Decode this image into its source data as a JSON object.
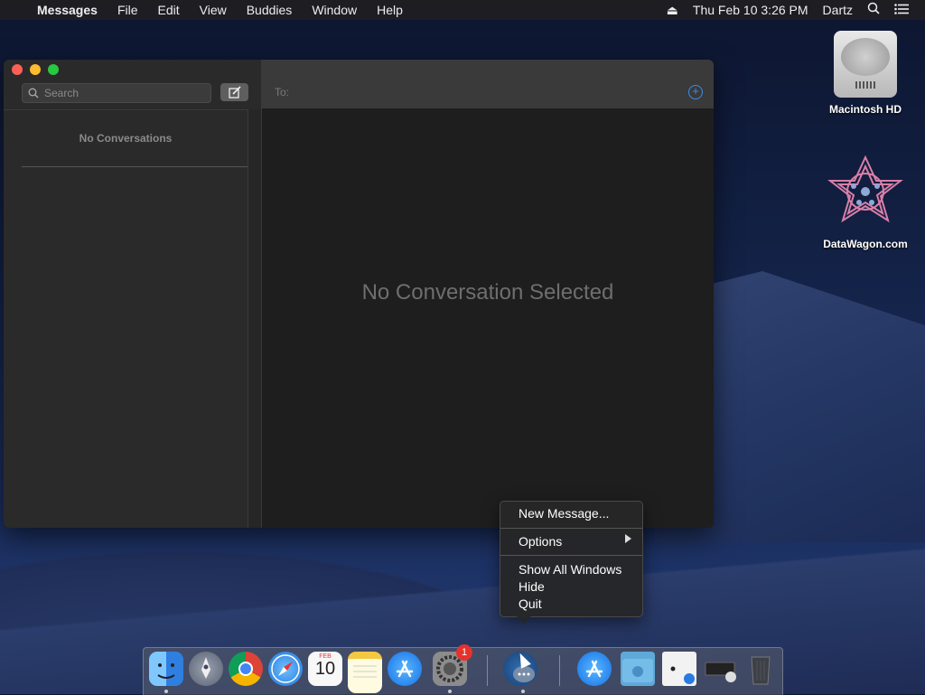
{
  "menubar": {
    "app": "Messages",
    "items": [
      "File",
      "Edit",
      "View",
      "Buddies",
      "Window",
      "Help"
    ],
    "datetime": "Thu Feb 10  3:26 PM",
    "user": "Dartz"
  },
  "desktop": {
    "icons": [
      {
        "label": "Macintosh HD"
      },
      {
        "label": "DataWagon.com"
      }
    ]
  },
  "window": {
    "search_placeholder": "Search",
    "no_conversations": "No Conversations",
    "to_label": "To:",
    "no_selected": "No Conversation Selected"
  },
  "context_menu": {
    "new_message": "New Message...",
    "options": "Options",
    "show_all": "Show All Windows",
    "hide": "Hide",
    "quit": "Quit"
  },
  "dock": {
    "system_prefs_badge": "1",
    "calendar_month": "FEB",
    "calendar_day": "10"
  },
  "colors": {
    "accent": "#3a8ee6",
    "badge": "#e5322d"
  }
}
